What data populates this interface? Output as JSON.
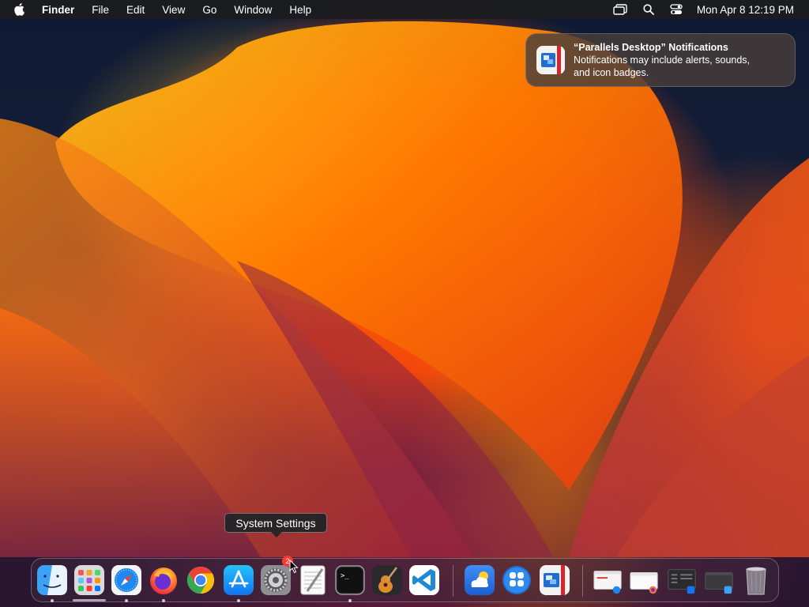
{
  "menubar": {
    "app_name": "Finder",
    "menus": [
      "File",
      "Edit",
      "View",
      "Go",
      "Window",
      "Help"
    ],
    "status_icons": [
      "screen-mirroring-icon",
      "spotlight-search-icon",
      "control-center-icon"
    ],
    "clock": "Mon Apr 8  12:19 PM"
  },
  "notification": {
    "title": "“Parallels Desktop” Notifications",
    "body_line1": "Notifications may include alerts, sounds,",
    "body_line2": "and icon badges.",
    "icon": "parallels-desktop-icon"
  },
  "tooltip": {
    "text": "System Settings"
  },
  "dock": {
    "apps": [
      {
        "name": "finder-icon",
        "running": true
      },
      {
        "name": "launchpad-icon",
        "running": false
      },
      {
        "name": "safari-icon",
        "running": true
      },
      {
        "name": "firefox-icon",
        "running": true
      },
      {
        "name": "chrome-icon",
        "running": false
      },
      {
        "name": "app-store-icon",
        "running": true
      },
      {
        "name": "system-settings-icon",
        "running": false,
        "badge": "2"
      },
      {
        "name": "textedit-icon",
        "running": false
      },
      {
        "name": "terminal-icon",
        "running": true
      },
      {
        "name": "garageband-icon",
        "running": false
      },
      {
        "name": "vscode-icon",
        "running": false
      },
      {
        "name": "weather-icon",
        "running": false
      },
      {
        "name": "parallels-toolbox-icon",
        "running": false
      },
      {
        "name": "parallels-desktop-icon",
        "running": false
      }
    ],
    "recent_windows": [
      "window-thumbnail-safari",
      "window-thumbnail-firefox",
      "window-thumbnail-app-store",
      "window-thumbnail-finder"
    ],
    "trash": "trash-icon"
  }
}
